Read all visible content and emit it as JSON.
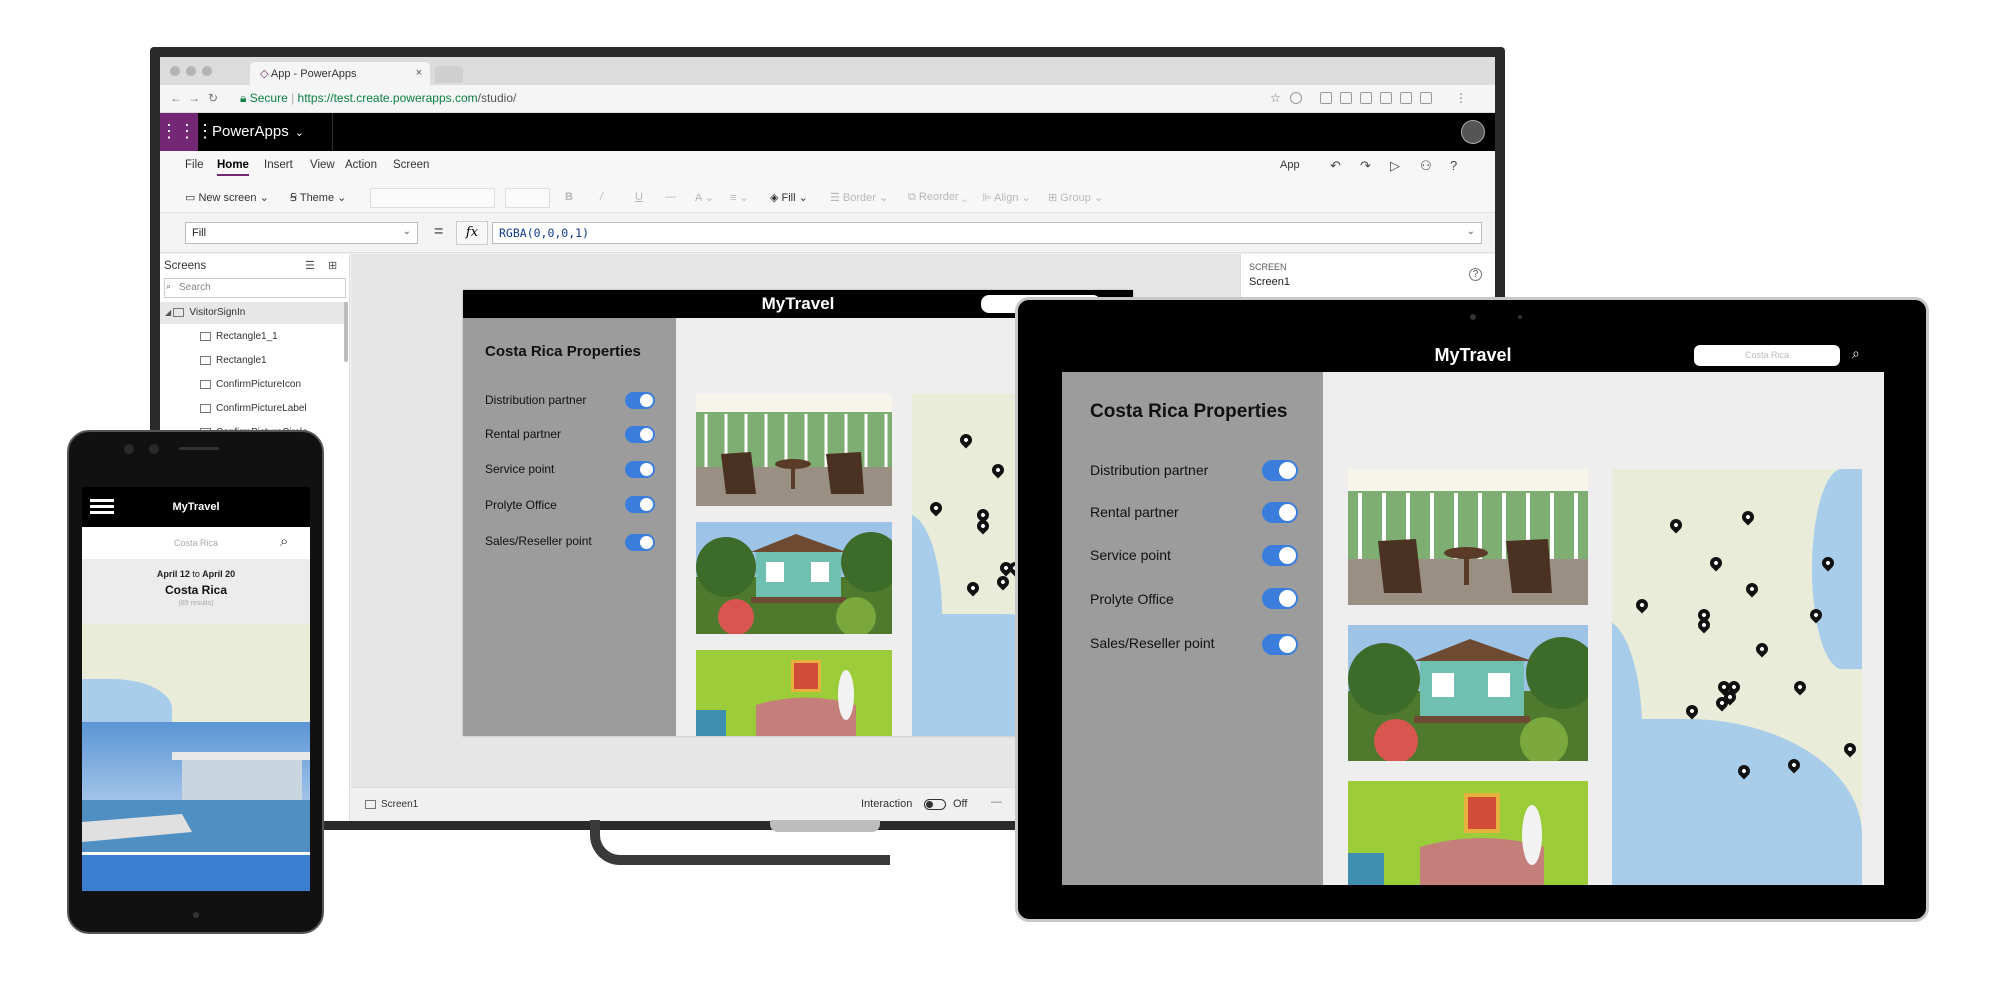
{
  "browser": {
    "tab_title": "App - PowerApps",
    "tab_close": "×",
    "secure_label": "Secure",
    "url_host": "https://test.create.powerapps.com",
    "url_path": "/studio/"
  },
  "powerapps": {
    "app_name": "PowerApps",
    "menu": [
      "File",
      "Home",
      "Insert",
      "View",
      "Action",
      "Screen"
    ],
    "active_menu": "Home",
    "app_label": "App",
    "ribbon": {
      "new_screen": "New screen",
      "theme": "Theme",
      "fill": "Fill",
      "border": "Border",
      "reorder": "Reorder",
      "align": "Align",
      "group": "Group"
    },
    "property": "Fill",
    "equals": "=",
    "fx": "fx",
    "formula": "RGBA(0,0,0,1)",
    "screens_title": "Screens",
    "search_placeholder": "Search",
    "tree": [
      "VisitorSignIn",
      "Rectangle1_1",
      "Rectangle1",
      "ConfirmPictureIcon",
      "ConfirmPictureLabel",
      "ConfirmPictureCircle"
    ],
    "props_section": "SCREEN",
    "props_value": "Screen1",
    "status_screen": "Screen1",
    "interaction_label": "Interaction",
    "interaction_state": "Off"
  },
  "app": {
    "brand": "MyTravel",
    "section_title": "Costa Rica Properties",
    "toggles": [
      "Distribution partner",
      "Rental partner",
      "Service point",
      "Prolyte Office",
      "Sales/Reseller point"
    ],
    "search_value": "Costa Rica"
  },
  "phone": {
    "brand": "MyTravel",
    "search_value": "Costa Rica",
    "date_from": "April 12",
    "date_to_word": "to",
    "date_to": "April 20",
    "location": "Costa Rica",
    "results": "(89 results)"
  },
  "colors": {
    "purple": "#742774",
    "toggle_blue": "#3b7ddd",
    "sidebar_gray": "#9c9c9c"
  }
}
